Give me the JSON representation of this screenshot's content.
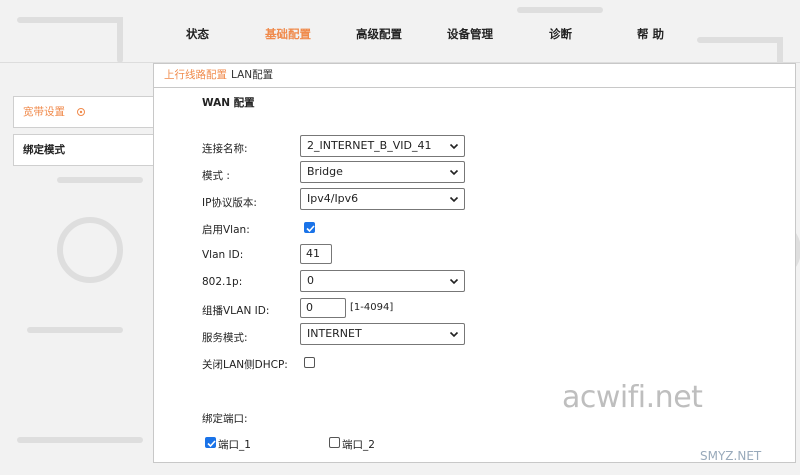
{
  "nav": {
    "items": [
      {
        "label": "状态",
        "active": false
      },
      {
        "label": "基础配置",
        "active": true
      },
      {
        "label": "高级配置",
        "active": false
      },
      {
        "label": "设备管理",
        "active": false
      },
      {
        "label": "诊断",
        "active": false
      },
      {
        "label": "帮 助",
        "active": false
      }
    ]
  },
  "sidebar": {
    "items": [
      {
        "label": "宽带设置",
        "active": true
      },
      {
        "label": "绑定模式",
        "active": false
      }
    ]
  },
  "breadcrumb": {
    "parent": "上行线路配置",
    "current": "LAN配置"
  },
  "form": {
    "section_title": "WAN 配置",
    "connection_name": {
      "label": "连接名称:",
      "value": "2_INTERNET_B_VID_41"
    },
    "mode": {
      "label": "模式 :",
      "value": "Bridge"
    },
    "ip_version": {
      "label": "IP协议版本:",
      "value": "Ipv4/Ipv6"
    },
    "enable_vlan": {
      "label": "启用Vlan:",
      "checked": true
    },
    "vlan_id": {
      "label": "Vlan ID:",
      "value": "41"
    },
    "dot1p": {
      "label": "802.1p:",
      "value": "0"
    },
    "multicast_vlan": {
      "label": "组播VLAN ID:",
      "value": "0",
      "hint": "[1-4094]"
    },
    "service_mode": {
      "label": "服务模式:",
      "value": "INTERNET"
    },
    "disable_lan_dhcp": {
      "label": "关闭LAN侧DHCP:",
      "checked": false
    },
    "bind_ports": {
      "label": "绑定端口:",
      "ports": [
        {
          "label": "端口_1",
          "checked": true
        },
        {
          "label": "端口_2",
          "checked": false
        }
      ]
    }
  },
  "watermarks": {
    "big": "acwifi.net",
    "small": "SMYZ.NET"
  },
  "colors": {
    "accent": "#f08a4b",
    "checkbox_blue": "#1a73e8"
  }
}
